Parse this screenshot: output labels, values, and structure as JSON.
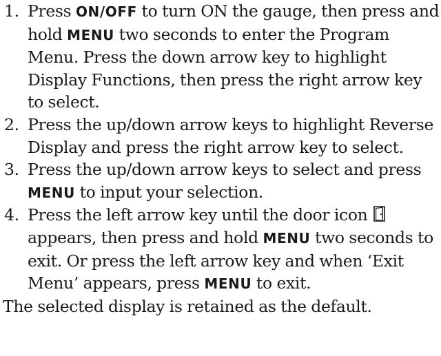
{
  "keys": {
    "on_off": "ON/OFF",
    "menu": "MENU"
  },
  "icons": {
    "door": "door-icon"
  },
  "steps": [
    {
      "number": "1.",
      "t1": "Press ",
      "t2": " to turn ON the gauge, then press and hold ",
      "t3": " two seconds to enter the Program Menu. Press the down arrow key to highlight Display Functions, then press the right arrow key to select."
    },
    {
      "number": "2.",
      "t1": "Press the up/down arrow keys to highlight Reverse Display and press the right arrow key to select."
    },
    {
      "number": "3.",
      "t1": "Press the up/down arrow keys to select and press ",
      "t2": " to input your selection."
    },
    {
      "number": "4.",
      "t1": "Press the left arrow key until the door icon ",
      "t2": " appears, then press and hold ",
      "t3": " two seconds to exit. Or press the left arrow key and when ‘Exit Menu’ appears, press ",
      "t4": " to exit."
    }
  ],
  "footer": "The selected display is retained as the default."
}
